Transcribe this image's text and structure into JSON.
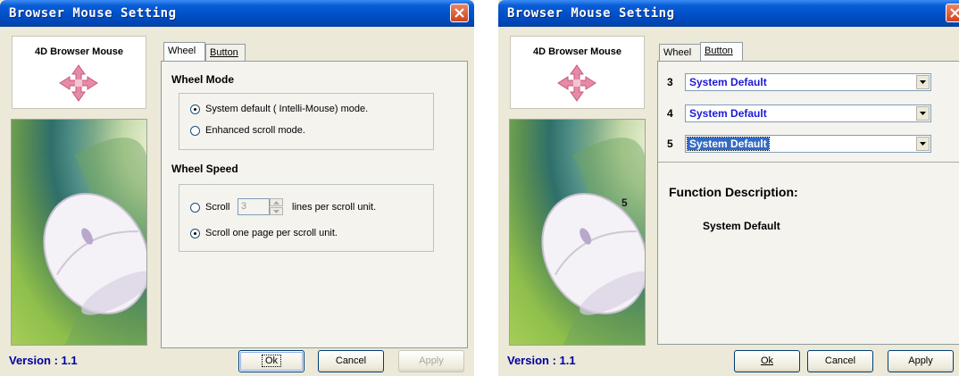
{
  "window_left": {
    "title": "Browser Mouse Setting",
    "logo_label": "4D Browser Mouse",
    "version": "Version : 1.1",
    "tabs": [
      {
        "label": "Wheel",
        "active": true
      },
      {
        "label": "Button",
        "active": false
      }
    ],
    "wheel_mode": {
      "title": "Wheel Mode",
      "options": [
        "System default ( Intelli-Mouse) mode.",
        "Enhanced scroll mode."
      ],
      "selected_index": 0
    },
    "wheel_speed": {
      "title": "Wheel Speed",
      "scroll_label": "Scroll",
      "lines_value": "3",
      "lines_suffix": "lines per scroll unit.",
      "page_option": "Scroll one page per scroll unit.",
      "selected": "page"
    },
    "buttons": {
      "ok": "Ok",
      "cancel": "Cancel",
      "apply": "Apply"
    }
  },
  "window_right": {
    "title": "Browser Mouse Setting",
    "logo_label": "4D Browser Mouse",
    "version": "Version : 1.1",
    "photo_label": "5",
    "tabs": [
      {
        "label": "Wheel",
        "active": false
      },
      {
        "label": "Button",
        "active": true
      }
    ],
    "button_rows": [
      {
        "number": "3",
        "value": "System Default"
      },
      {
        "number": "4",
        "value": "System Default"
      },
      {
        "number": "5",
        "value": "System Default"
      }
    ],
    "selected_row_index": 2,
    "function_description": {
      "title": "Function Description:",
      "value": "System Default"
    },
    "buttons": {
      "ok": "Ok",
      "cancel": "Cancel",
      "apply": "Apply"
    }
  },
  "colors": {
    "titlebar": "#0054e3",
    "face": "#ece9d8",
    "version_text": "#0000a0",
    "combo_text": "#1a1ad6",
    "selection": "#316ac5"
  },
  "icons": [
    "close-icon",
    "four-way-arrow-icon",
    "dropdown-arrow-icon",
    "spin-up-icon",
    "spin-down-icon"
  ]
}
